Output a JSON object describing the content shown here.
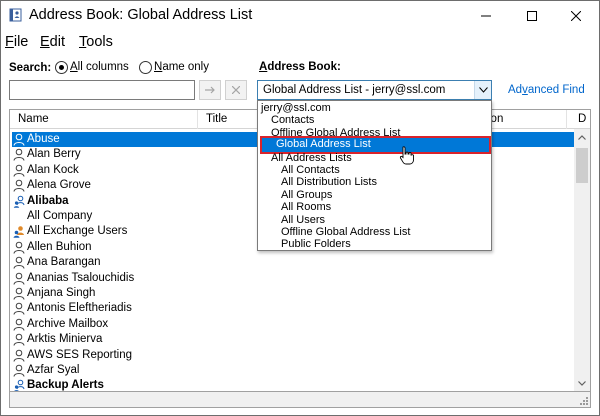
{
  "window": {
    "title": "Address Book: Global Address List",
    "minimize_glyph": "—",
    "maximize_glyph": "☐",
    "close_glyph": "✕"
  },
  "menu": {
    "file_first": "F",
    "file_rest": "ile",
    "edit_first": "E",
    "edit_rest": "dit",
    "tools_first": "T",
    "tools_rest": "ools"
  },
  "search": {
    "label": "Search:",
    "option_all": "All columns",
    "option_all_first": "A",
    "option_all_rest": "ll columns",
    "option_name_first": "N",
    "option_name_rest": "ame only",
    "selected": "All columns",
    "value": "",
    "go_glyph": "➝",
    "clear_glyph": "✕"
  },
  "address_book": {
    "label": "Address Book:",
    "label_first": "A",
    "label_after": "ddress Book:",
    "selected_value": "Global Address List - jerry@ssl.com",
    "advanced_find_first": "Ad",
    "advanced_find_u": "v",
    "advanced_find_rest": "anced Find",
    "options": [
      {
        "text": "jerry@ssl.com",
        "indent": 0
      },
      {
        "text": "Contacts",
        "indent": 1
      },
      {
        "text": "Offline Global Address List",
        "indent": 1
      },
      {
        "text": "Global Address List",
        "indent": 1
      },
      {
        "text": "All Address Lists",
        "indent": 1
      },
      {
        "text": "All Contacts",
        "indent": 2
      },
      {
        "text": "All Distribution Lists",
        "indent": 2
      },
      {
        "text": "All Groups",
        "indent": 2
      },
      {
        "text": "All Rooms",
        "indent": 2
      },
      {
        "text": "All Users",
        "indent": 2
      },
      {
        "text": "Offline Global Address List",
        "indent": 2
      },
      {
        "text": "Public Folders",
        "indent": 2
      }
    ],
    "highlighted_option": "Global Address List"
  },
  "columns": {
    "name": "Name",
    "title": "Title",
    "partial_location": "ion",
    "partial_d": "D"
  },
  "entries": [
    {
      "name": "Abuse",
      "type": "user",
      "selected": true
    },
    {
      "name": "Alan Berry",
      "type": "user"
    },
    {
      "name": "Alan Kock",
      "type": "user"
    },
    {
      "name": "Alena Grove",
      "type": "user"
    },
    {
      "name": "Alibaba",
      "type": "group",
      "bold": true
    },
    {
      "name": "All Company",
      "type": "none"
    },
    {
      "name": "All Exchange Users",
      "type": "dynamic-group"
    },
    {
      "name": "Allen Buhion",
      "type": "user"
    },
    {
      "name": "Ana Barangan",
      "type": "user"
    },
    {
      "name": "Ananias Tsalouchidis",
      "type": "user"
    },
    {
      "name": "Anjana Singh",
      "type": "user"
    },
    {
      "name": "Antonis Eleftheriadis",
      "type": "user"
    },
    {
      "name": "Archive Mailbox",
      "type": "user"
    },
    {
      "name": "Arktis Minierva",
      "type": "user"
    },
    {
      "name": "AWS SES Reporting",
      "type": "user"
    },
    {
      "name": "Azfar Syal",
      "type": "user"
    },
    {
      "name": "Backup Alerts",
      "type": "group",
      "bold": true
    }
  ],
  "colors": {
    "selection": "#0078d7",
    "link": "#0066cc",
    "highlight_border": "#d9232b"
  },
  "icons": {
    "app": "address-book-icon",
    "user": "user-icon",
    "group": "group-icon",
    "dynamic_group": "dynamic-group-icon"
  }
}
